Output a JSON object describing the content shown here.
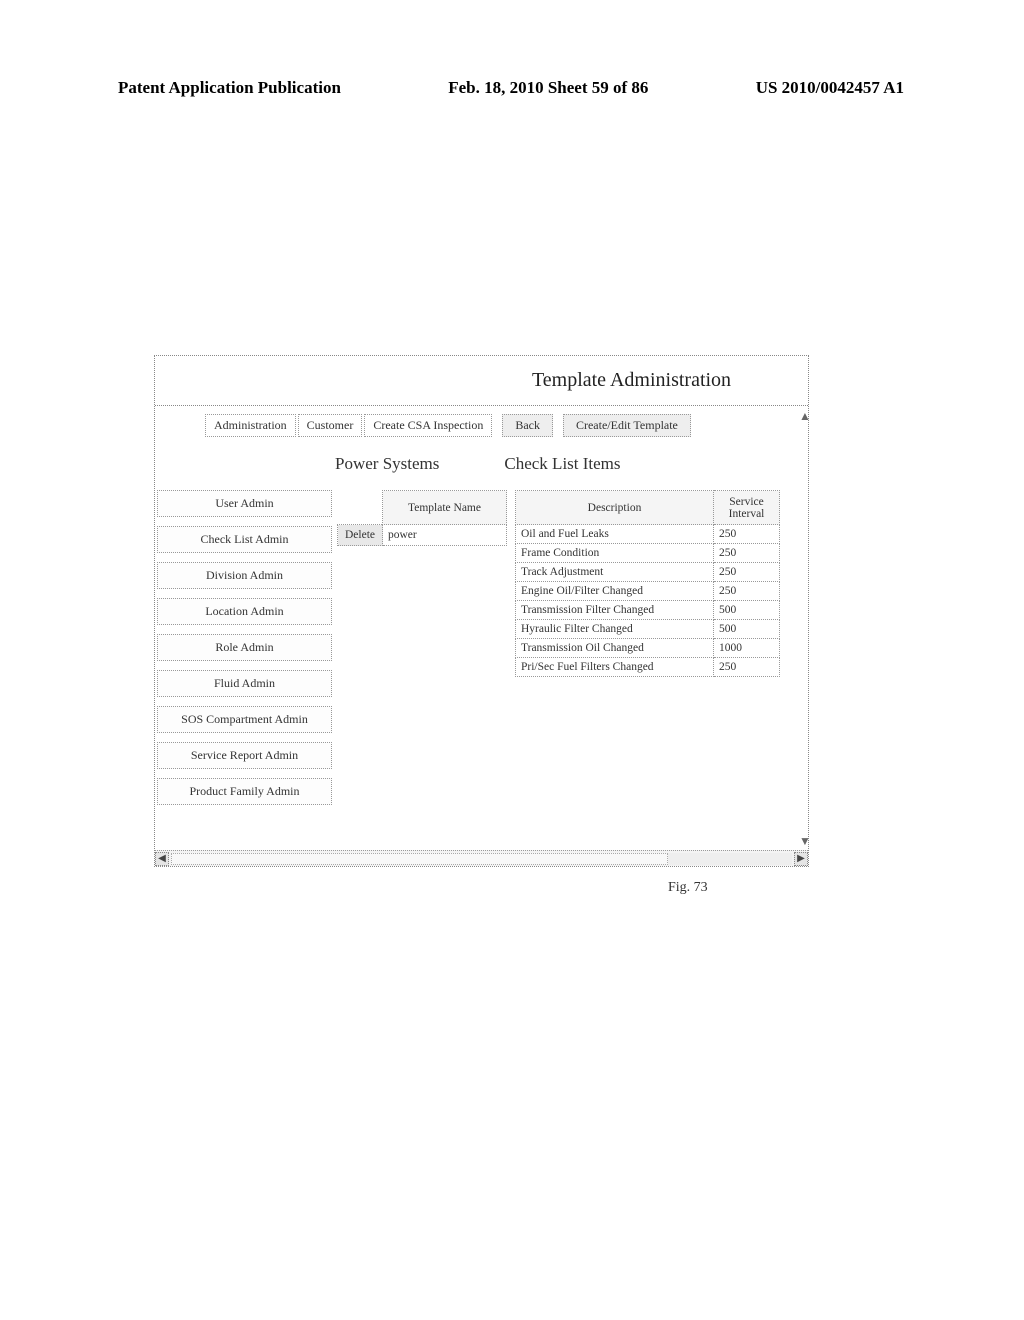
{
  "header": {
    "left": "Patent Application Publication",
    "center": "Feb. 18, 2010  Sheet 59 of 86",
    "right": "US 2010/0042457 A1"
  },
  "window": {
    "title": "Template Administration"
  },
  "top_nav": {
    "links": [
      "Administration",
      "Customer",
      "Create CSA Inspection"
    ],
    "back_btn": "Back",
    "create_btn": "Create/Edit Template"
  },
  "sections": {
    "power": "Power Systems",
    "checklist": "Check List Items"
  },
  "sidebar": {
    "items": [
      "User Admin",
      "Check List Admin",
      "Division Admin",
      "Location Admin",
      "Role Admin",
      "Fluid Admin",
      "SOS Compartment Admin",
      "Service Report Admin",
      "Product Family Admin"
    ]
  },
  "template_table": {
    "col_action": "",
    "col_name": "Template Name",
    "delete_label": "Delete",
    "row_name": "power"
  },
  "checklist_table": {
    "col_desc": "Description",
    "col_interval": "Service Interval",
    "rows": [
      {
        "desc": "Oil and Fuel Leaks",
        "interval": "250"
      },
      {
        "desc": "Frame Condition",
        "interval": "250"
      },
      {
        "desc": "Track Adjustment",
        "interval": "250"
      },
      {
        "desc": "Engine Oil/Filter Changed",
        "interval": "250"
      },
      {
        "desc": "Transmission Filter Changed",
        "interval": "500"
      },
      {
        "desc": "Hyraulic Filter Changed",
        "interval": "500"
      },
      {
        "desc": "Transmission Oil Changed",
        "interval": "1000"
      },
      {
        "desc": "Pri/Sec Fuel Filters Changed",
        "interval": "250"
      }
    ]
  },
  "figure_label": "Fig. 73"
}
